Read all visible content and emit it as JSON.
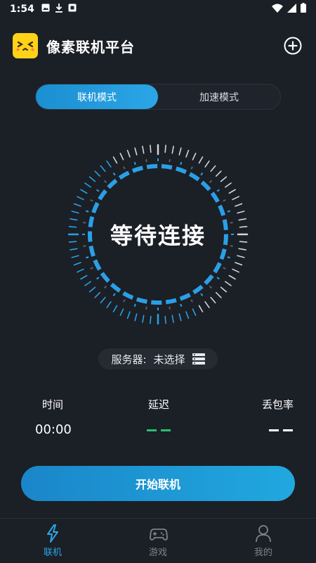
{
  "status_bar": {
    "time": "1:54",
    "icons": [
      "image-icon",
      "download-icon",
      "app-icon",
      "wifi-icon",
      "signal-icon",
      "battery-icon"
    ]
  },
  "header": {
    "title": "像素联机平台",
    "add_icon": "plus-circle-icon"
  },
  "mode_toggle": {
    "tabs": [
      {
        "label": "联机模式",
        "active": true
      },
      {
        "label": "加速模式",
        "active": false
      }
    ]
  },
  "dial": {
    "status": "等待连接",
    "accent_color": "#2b9fe6"
  },
  "server": {
    "label": "服务器:",
    "value": "未选择",
    "icon": "server-list-icon"
  },
  "stats": {
    "time": {
      "title": "时间",
      "value": "00:00"
    },
    "latency": {
      "title": "延迟",
      "value": "– –",
      "color": "#27c06b"
    },
    "packet_loss": {
      "title": "丢包率",
      "value": "– –",
      "color": "#ffffff"
    }
  },
  "start_button": {
    "label": "开始联机"
  },
  "bottom_nav": {
    "items": [
      {
        "label": "联机",
        "icon": "lightning-icon",
        "active": true
      },
      {
        "label": "游戏",
        "icon": "gamepad-icon",
        "active": false
      },
      {
        "label": "我的",
        "icon": "person-icon",
        "active": false
      }
    ]
  },
  "colors": {
    "background": "#1b1f26",
    "accent": "#2aa6e6",
    "logo": "#ffd21a"
  }
}
